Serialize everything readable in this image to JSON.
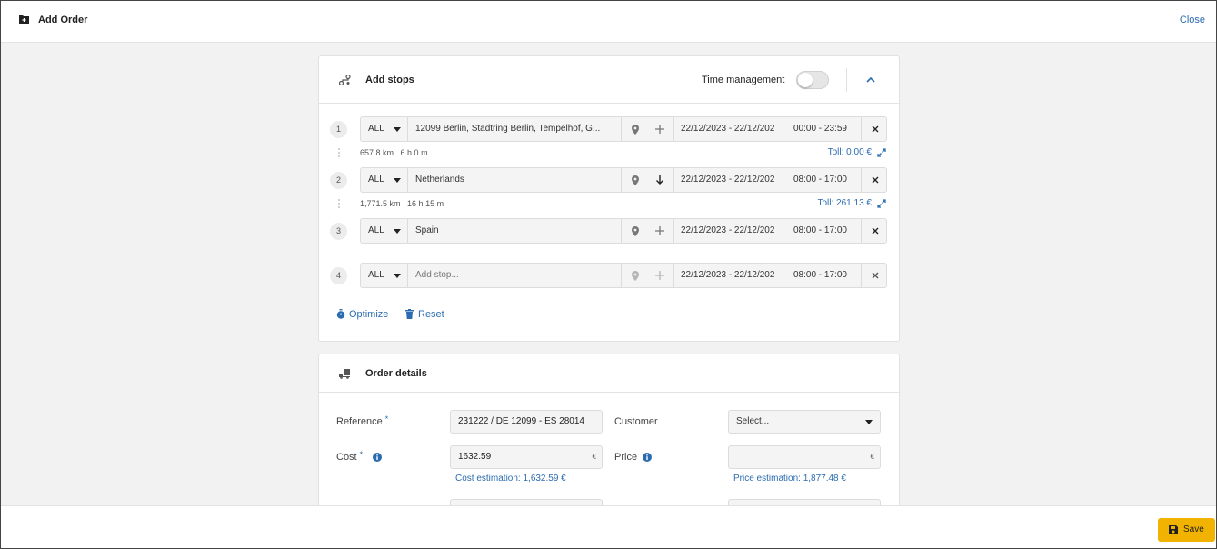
{
  "header": {
    "title": "Add Order",
    "close_label": "Close"
  },
  "stops_card": {
    "title": "Add stops",
    "time_management_label": "Time management",
    "time_management_on": false,
    "stops": [
      {
        "number": "1",
        "type": "ALL",
        "address": "12099 Berlin, Stadtring Berlin, Tempelhof, G...",
        "date": "22/12/2023 - 22/12/202",
        "time": "00:00 - 23:59"
      },
      {
        "number": "2",
        "type": "ALL",
        "address": "Netherlands",
        "date": "22/12/2023 - 22/12/202",
        "time": "08:00 - 17:00"
      },
      {
        "number": "3",
        "type": "ALL",
        "address": "Spain",
        "date": "22/12/2023 - 22/12/202",
        "time": "08:00 - 17:00"
      },
      {
        "number": "4",
        "type": "ALL",
        "address_placeholder": "Add stop...",
        "date": "22/12/2023 - 22/12/202",
        "time": "08:00 - 17:00"
      }
    ],
    "legs": [
      {
        "distance": "657.8 km",
        "duration": "6 h 0 m",
        "toll": "Toll: 0.00 €"
      },
      {
        "distance": "1,771.5 km",
        "duration": "16 h 15 m",
        "toll": "Toll: 261.13 €"
      }
    ],
    "optimize_label": "Optimize",
    "reset_label": "Reset"
  },
  "details_card": {
    "title": "Order details",
    "reference_label": "Reference",
    "reference_value": "231222 / DE 12099 - ES 28014",
    "customer_label": "Customer",
    "customer_value": "Select...",
    "cost_label": "Cost",
    "cost_value": "1632.59",
    "cost_unit": "€",
    "cost_estimation": "Cost estimation: 1,632.59 €",
    "price_label": "Price",
    "price_value": "",
    "price_unit": "€",
    "price_estimation": "Price estimation: 1,877.48 €",
    "required_mark": "*"
  },
  "footer": {
    "save_label": "Save"
  },
  "colors": {
    "accent": "#2b6cb0",
    "save": "#f2b300"
  }
}
